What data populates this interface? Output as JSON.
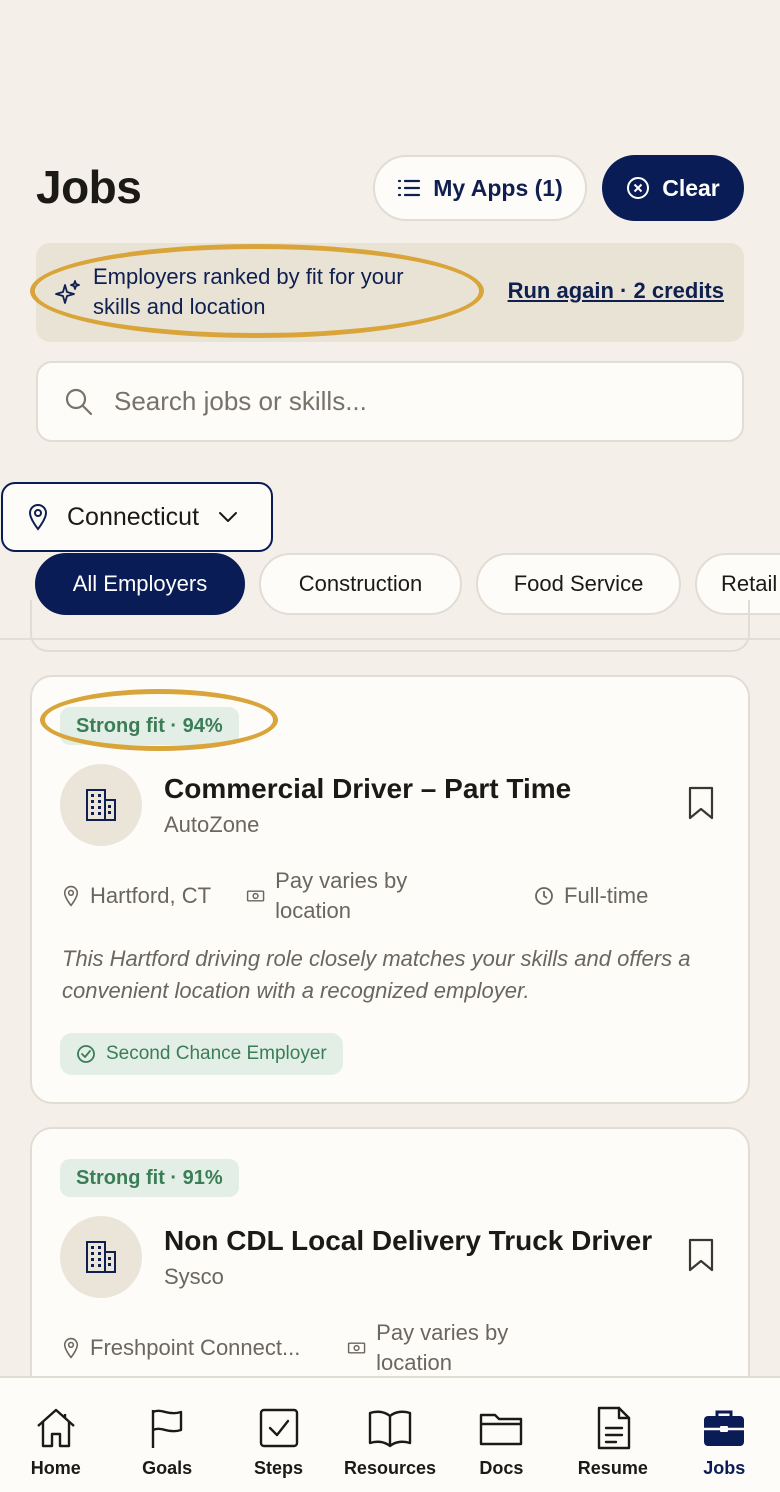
{
  "header": {
    "title": "Jobs",
    "my_apps_label": "My Apps (1)",
    "clear_label": "Clear"
  },
  "ranked_banner": {
    "message": "Employers ranked by fit for your skills and location",
    "run_again_label": "Run again · 2 credits"
  },
  "search": {
    "placeholder": "Search jobs or skills..."
  },
  "location": {
    "selected": "Connecticut"
  },
  "categories": [
    {
      "label": "All Employers",
      "active": true
    },
    {
      "label": "Construction",
      "active": false
    },
    {
      "label": "Food Service",
      "active": false
    },
    {
      "label": "Retail",
      "active": false
    }
  ],
  "jobs": [
    {
      "fit": "Strong fit · 94%",
      "title": "Commercial Driver – Part Time",
      "company": "AutoZone",
      "location": "Hartford, CT",
      "pay": "Pay varies by location",
      "type": "Full-time",
      "description": "This Hartford driving role closely matches your skills and offers a convenient location with a recognized employer.",
      "badge": "Second Chance Employer"
    },
    {
      "fit": "Strong fit · 91%",
      "title": "Non CDL Local Delivery Truck Driver",
      "company": "Sysco",
      "location": "Freshpoint Connect...",
      "pay": "Pay varies by location"
    }
  ],
  "bottom_nav": [
    {
      "label": "Home",
      "icon": "home-icon",
      "active": false
    },
    {
      "label": "Goals",
      "icon": "flag-icon",
      "active": false
    },
    {
      "label": "Steps",
      "icon": "checkbox-icon",
      "active": false
    },
    {
      "label": "Resources",
      "icon": "book-icon",
      "active": false
    },
    {
      "label": "Docs",
      "icon": "folder-icon",
      "active": false
    },
    {
      "label": "Resume",
      "icon": "document-icon",
      "active": false
    },
    {
      "label": "Jobs",
      "icon": "briefcase-icon",
      "active": true
    }
  ],
  "colors": {
    "navy": "#0a1c55",
    "background": "#f4f0e9",
    "fit_green": "#3a7d56",
    "highlight_gold": "#d9a53a"
  }
}
